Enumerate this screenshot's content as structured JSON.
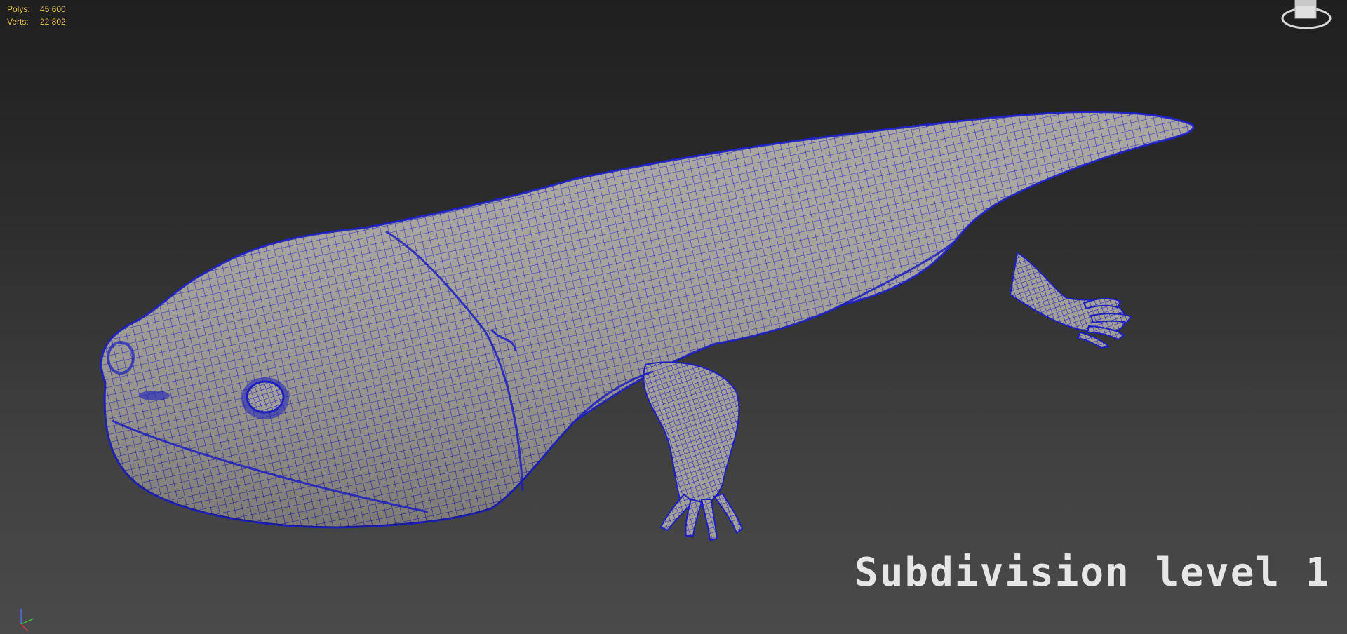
{
  "stats": {
    "polys_label": "Polys:",
    "polys_value": "45 600",
    "verts_label": "Verts:",
    "verts_value": "22 802"
  },
  "overlay": {
    "label": "Subdivision level 1"
  },
  "axis_gizmo": {
    "z_label": "z",
    "x_label": "x",
    "y_label": "y"
  },
  "model": {
    "subject": "salamander-mesh",
    "surface_color": "#a4a09a",
    "wire_color": "#1d1fc0",
    "background_top": "#1f1f1f",
    "background_bottom": "#4a4a4a"
  },
  "icons": {
    "viewcube": "viewcube-icon",
    "axis": "axis-tripod-icon"
  }
}
